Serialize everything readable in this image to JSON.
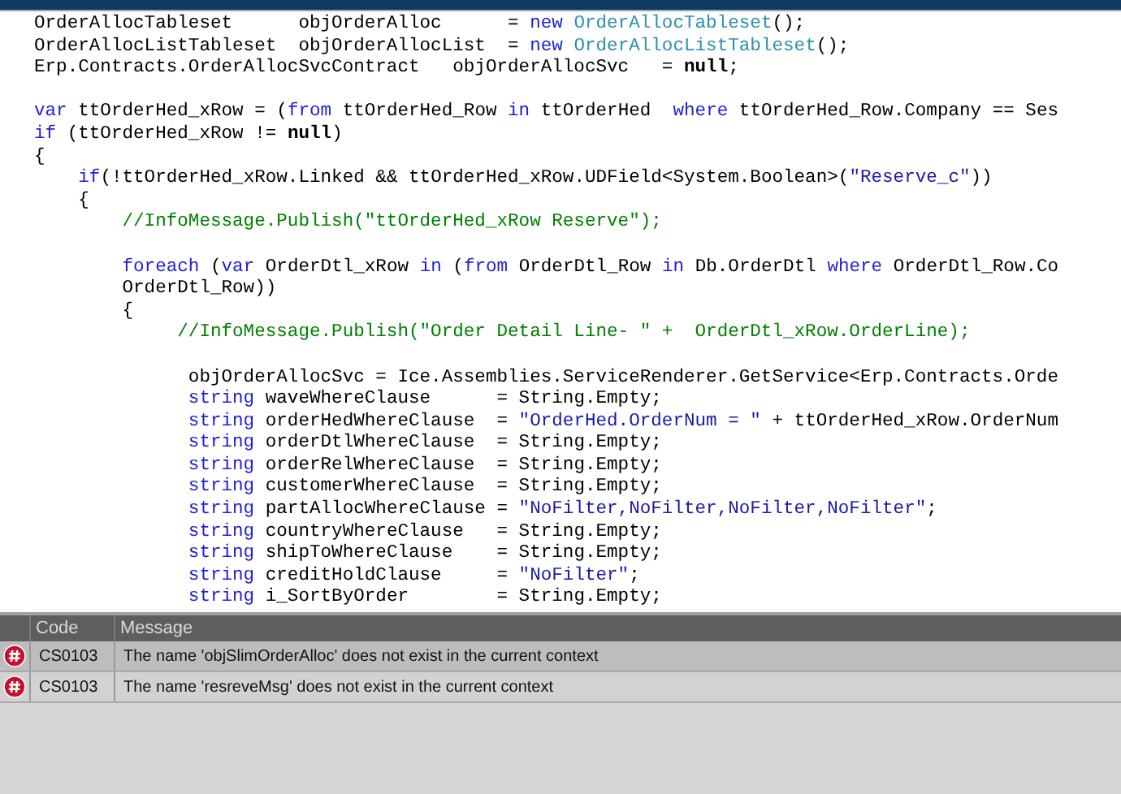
{
  "editor": {
    "lines": [
      {
        "kind": "code",
        "tokens": [
          {
            "kind": "plain",
            "text": "OrderAllocTableset      objOrderAlloc      = "
          },
          {
            "kind": "keyword",
            "text": "new "
          },
          {
            "kind": "type",
            "text": "OrderAllocTableset"
          },
          {
            "kind": "plain",
            "text": "();"
          }
        ]
      },
      {
        "kind": "code",
        "tokens": [
          {
            "kind": "plain",
            "text": "OrderAllocListTableset  objOrderAllocList  = "
          },
          {
            "kind": "keyword",
            "text": "new "
          },
          {
            "kind": "type",
            "text": "OrderAllocListTableset"
          },
          {
            "kind": "plain",
            "text": "();"
          }
        ]
      },
      {
        "kind": "code",
        "tokens": [
          {
            "kind": "plain",
            "text": "Erp.Contracts.OrderAllocSvcContract   objOrderAllocSvc   = "
          },
          {
            "kind": "bold",
            "text": "null"
          },
          {
            "kind": "plain",
            "text": ";"
          }
        ]
      },
      {
        "kind": "blank"
      },
      {
        "kind": "code",
        "tokens": [
          {
            "kind": "keyword",
            "text": "var"
          },
          {
            "kind": "plain",
            "text": " ttOrderHed_xRow = ("
          },
          {
            "kind": "keyword",
            "text": "from"
          },
          {
            "kind": "plain",
            "text": " ttOrderHed_Row "
          },
          {
            "kind": "keyword",
            "text": "in"
          },
          {
            "kind": "plain",
            "text": " ttOrderHed  "
          },
          {
            "kind": "keyword",
            "text": "where"
          },
          {
            "kind": "plain",
            "text": " ttOrderHed_Row.Company == Ses"
          }
        ]
      },
      {
        "kind": "code",
        "tokens": [
          {
            "kind": "keyword",
            "text": "if"
          },
          {
            "kind": "plain",
            "text": " (ttOrderHed_xRow != "
          },
          {
            "kind": "bold",
            "text": "null"
          },
          {
            "kind": "plain",
            "text": ")"
          }
        ]
      },
      {
        "kind": "code",
        "tokens": [
          {
            "kind": "plain",
            "text": "{"
          }
        ]
      },
      {
        "kind": "code",
        "tokens": [
          {
            "kind": "keyword",
            "text": "    if"
          },
          {
            "kind": "plain",
            "text": "(!ttOrderHed_xRow.Linked && ttOrderHed_xRow.UDField<System.Boolean>("
          },
          {
            "kind": "string",
            "text": "\"Reserve_c\""
          },
          {
            "kind": "plain",
            "text": "))"
          }
        ]
      },
      {
        "kind": "code",
        "tokens": [
          {
            "kind": "plain",
            "text": "    {"
          }
        ]
      },
      {
        "kind": "code",
        "tokens": [
          {
            "kind": "comment",
            "text": "        //InfoMessage.Publish(\"ttOrderHed_xRow Reserve\");"
          }
        ]
      },
      {
        "kind": "blank"
      },
      {
        "kind": "code",
        "tokens": [
          {
            "kind": "keyword",
            "text": "        foreach"
          },
          {
            "kind": "plain",
            "text": " ("
          },
          {
            "kind": "keyword",
            "text": "var"
          },
          {
            "kind": "plain",
            "text": " OrderDtl_xRow "
          },
          {
            "kind": "keyword",
            "text": "in"
          },
          {
            "kind": "plain",
            "text": " ("
          },
          {
            "kind": "keyword",
            "text": "from"
          },
          {
            "kind": "plain",
            "text": " OrderDtl_Row "
          },
          {
            "kind": "keyword",
            "text": "in"
          },
          {
            "kind": "plain",
            "text": " Db.OrderDtl "
          },
          {
            "kind": "keyword",
            "text": "where"
          },
          {
            "kind": "plain",
            "text": " OrderDtl_Row.Co"
          }
        ]
      },
      {
        "kind": "code",
        "tokens": [
          {
            "kind": "plain",
            "text": "        OrderDtl_Row))"
          }
        ]
      },
      {
        "kind": "code",
        "tokens": [
          {
            "kind": "plain",
            "text": "        {"
          }
        ]
      },
      {
        "kind": "code",
        "tokens": [
          {
            "kind": "comment",
            "text": "             //InfoMessage.Publish(\"Order Detail Line- \" +  OrderDtl_xRow.OrderLine);"
          }
        ]
      },
      {
        "kind": "blank"
      },
      {
        "kind": "code",
        "tokens": [
          {
            "kind": "plain",
            "text": "              objOrderAllocSvc = Ice.Assemblies.ServiceRenderer.GetService<Erp.Contracts.Orde"
          }
        ]
      },
      {
        "kind": "code",
        "tokens": [
          {
            "kind": "keyword",
            "text": "              string"
          },
          {
            "kind": "plain",
            "text": " waveWhereClause      = String.Empty;"
          }
        ]
      },
      {
        "kind": "code",
        "tokens": [
          {
            "kind": "keyword",
            "text": "              string"
          },
          {
            "kind": "plain",
            "text": " orderHedWhereClause  = "
          },
          {
            "kind": "string",
            "text": "\"OrderHed.OrderNum = \""
          },
          {
            "kind": "plain",
            "text": " + ttOrderHed_xRow.OrderNum"
          }
        ]
      },
      {
        "kind": "code",
        "tokens": [
          {
            "kind": "keyword",
            "text": "              string"
          },
          {
            "kind": "plain",
            "text": " orderDtlWhereClause  = String.Empty;"
          }
        ]
      },
      {
        "kind": "code",
        "tokens": [
          {
            "kind": "keyword",
            "text": "              string"
          },
          {
            "kind": "plain",
            "text": " orderRelWhereClause  = String.Empty;"
          }
        ]
      },
      {
        "kind": "code",
        "tokens": [
          {
            "kind": "keyword",
            "text": "              string"
          },
          {
            "kind": "plain",
            "text": " customerWhereClause  = String.Empty;"
          }
        ]
      },
      {
        "kind": "code",
        "tokens": [
          {
            "kind": "keyword",
            "text": "              string"
          },
          {
            "kind": "plain",
            "text": " partAllocWhereClause = "
          },
          {
            "kind": "string",
            "text": "\"NoFilter,NoFilter,NoFilter,NoFilter\""
          },
          {
            "kind": "plain",
            "text": ";"
          }
        ]
      },
      {
        "kind": "code",
        "tokens": [
          {
            "kind": "keyword",
            "text": "              string"
          },
          {
            "kind": "plain",
            "text": " countryWhereClause   = String.Empty;"
          }
        ]
      },
      {
        "kind": "code",
        "tokens": [
          {
            "kind": "keyword",
            "text": "              string"
          },
          {
            "kind": "plain",
            "text": " shipToWhereClause    = String.Empty;"
          }
        ]
      },
      {
        "kind": "code",
        "tokens": [
          {
            "kind": "keyword",
            "text": "              string"
          },
          {
            "kind": "plain",
            "text": " creditHoldClause     = "
          },
          {
            "kind": "string",
            "text": "\"NoFilter\""
          },
          {
            "kind": "plain",
            "text": ";"
          }
        ]
      },
      {
        "kind": "code",
        "tokens": [
          {
            "kind": "keyword",
            "text": "              string"
          },
          {
            "kind": "plain",
            "text": " i_SortByOrder        = String.Empty;"
          }
        ]
      }
    ]
  },
  "error_list": {
    "columns": [
      "Code",
      "Message"
    ],
    "rows": [
      {
        "code": "CS0103",
        "message": "The name 'objSlimOrderAlloc' does not exist in the current context",
        "selected": true
      },
      {
        "code": "CS0103",
        "message": "The name 'resreveMsg' does not exist in the current context",
        "selected": false
      }
    ]
  }
}
